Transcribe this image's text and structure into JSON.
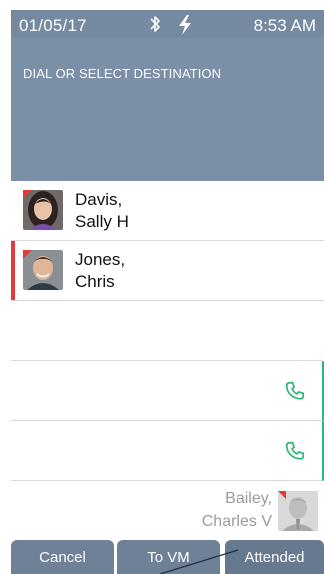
{
  "status_bar": {
    "date": "01/05/17",
    "time": "8:53 AM",
    "icons": [
      "bluetooth-icon",
      "power-bolt-icon"
    ]
  },
  "header": {
    "prompt": "DIAL OR SELECT DESTINATION"
  },
  "contacts": [
    {
      "name_line1": "Davis,",
      "name_line2": "Sally H",
      "avatar": "female-avatar",
      "selected": false
    },
    {
      "name_line1": "Jones,",
      "name_line2": "Chris",
      "avatar": "male-avatar",
      "selected": true
    }
  ],
  "agent": {
    "name_line1": "Bailey,",
    "name_line2": "Charles V",
    "avatar": "male-avatar"
  },
  "softkeys": {
    "cancel": "Cancel",
    "to_vm": "To VM",
    "attended": "Attended"
  },
  "colors": {
    "header_bg": "#7b8fa6",
    "softkey_bg": "#6f8196",
    "presence_red": "#e23b3b",
    "call_green": "#2bb673"
  }
}
